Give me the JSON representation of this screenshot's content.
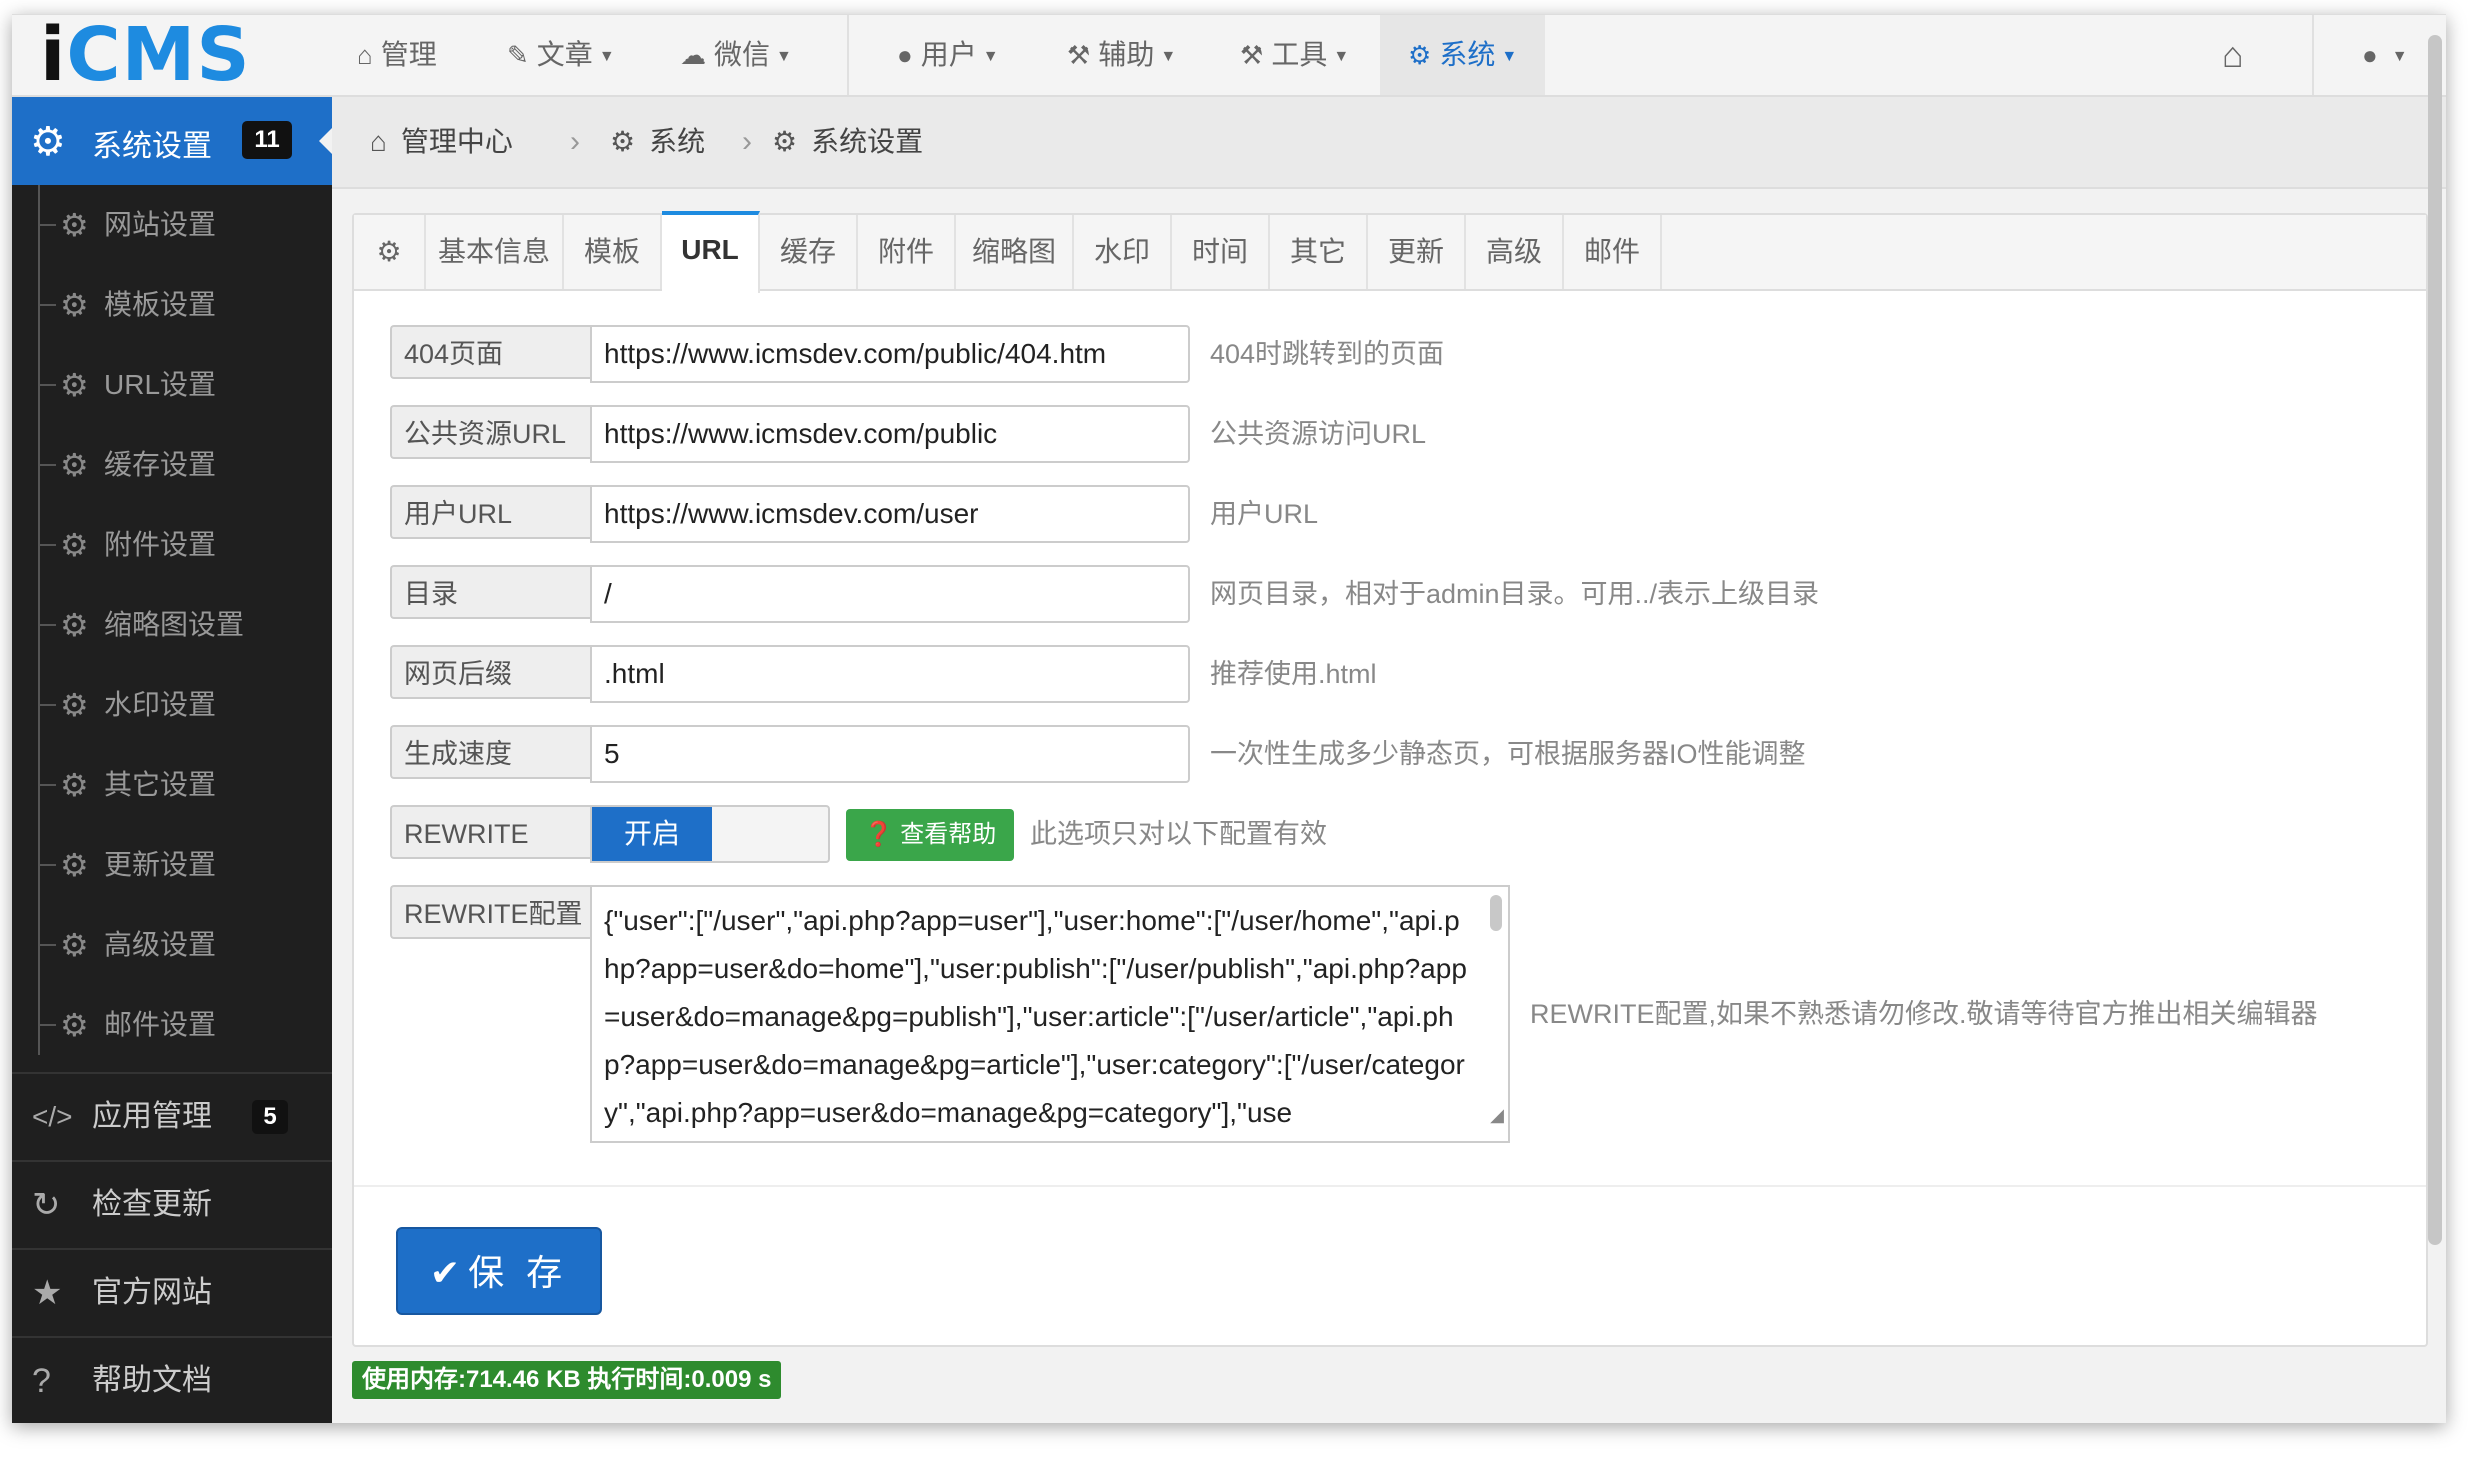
{
  "logo": {
    "first": "i",
    "rest": "CMS"
  },
  "navbar": {
    "items": [
      {
        "icon": "home-icon",
        "glyph": "⌂",
        "label": "管理"
      },
      {
        "icon": "edit-icon",
        "glyph": "✎",
        "label": "文章"
      },
      {
        "icon": "wechat-icon",
        "glyph": "☁",
        "label": "微信"
      },
      {
        "icon": "user-icon",
        "glyph": "●",
        "label": "用户"
      },
      {
        "icon": "gavel-icon",
        "glyph": "⚒",
        "label": "辅助"
      },
      {
        "icon": "tool-icon",
        "glyph": "⚒",
        "label": "工具"
      },
      {
        "icon": "gear-icon",
        "glyph": "⚙",
        "label": "系统"
      }
    ],
    "home_glyph": "⌂",
    "user_glyph": "●"
  },
  "sidebar": {
    "active": {
      "label": "系统设置",
      "badge": "11"
    },
    "sub_items": [
      "网站设置",
      "模板设置",
      "URL设置",
      "缓存设置",
      "附件设置",
      "缩略图设置",
      "水印设置",
      "其它设置",
      "更新设置",
      "高级设置",
      "邮件设置"
    ],
    "apps": {
      "label": "应用管理",
      "badge": "5",
      "glyph": "</>"
    },
    "check_update": {
      "label": "检查更新",
      "glyph": "↻"
    },
    "official_site": {
      "label": "官方网站",
      "glyph": "★"
    },
    "help_docs": {
      "label": "帮助文档",
      "glyph": "?"
    }
  },
  "breadcrumb": {
    "items": [
      "管理中心",
      "系统",
      "系统设置"
    ],
    "sep": "›"
  },
  "tabs": [
    "基本信息",
    "模板",
    "URL",
    "缓存",
    "附件",
    "缩略图",
    "水印",
    "时间",
    "其它",
    "更新",
    "高级",
    "邮件"
  ],
  "form": {
    "rows": [
      {
        "label": "404页面",
        "value": "https://www.icmsdev.com/public/404.htm",
        "help": "404时跳转到的页面"
      },
      {
        "label": "公共资源URL",
        "value": "https://www.icmsdev.com/public",
        "help": "公共资源访问URL"
      },
      {
        "label": "用户URL",
        "value": "https://www.icmsdev.com/user",
        "help": "用户URL"
      },
      {
        "label": "目录",
        "value": "/",
        "help": "网页目录，相对于admin目录。可用../表示上级目录"
      },
      {
        "label": "网页后缀",
        "value": ".html",
        "help": "推荐使用.html"
      },
      {
        "label": "生成速度",
        "value": "5",
        "help": "一次性生成多少静态页，可根据服务器IO性能调整"
      }
    ],
    "rewrite": {
      "label": "REWRITE",
      "state": "开启",
      "help_button": "查看帮助",
      "help": "此选项只对以下配置有效"
    },
    "rewrite_config": {
      "label": "REWRITE配置",
      "value": "{\"user\":[\"/user\",\"api.php?app=user\"],\"user:home\":[\"/user/home\",\"api.php?app=user&do=home\"],\"user:publish\":[\"/user/publish\",\"api.php?app=user&do=manage&pg=publish\"],\"user:article\":[\"/user/article\",\"api.php?app=user&do=manage&pg=article\"],\"user:category\":[\"/user/category\",\"api.php?app=user&do=manage&pg=category\"],\"use",
      "help": "REWRITE配置,如果不熟悉请勿修改.敬请等待官方推出相关编辑器"
    }
  },
  "save_label": "保 存",
  "status": "使用内存:714.46 KB 执行时间:0.009 s"
}
